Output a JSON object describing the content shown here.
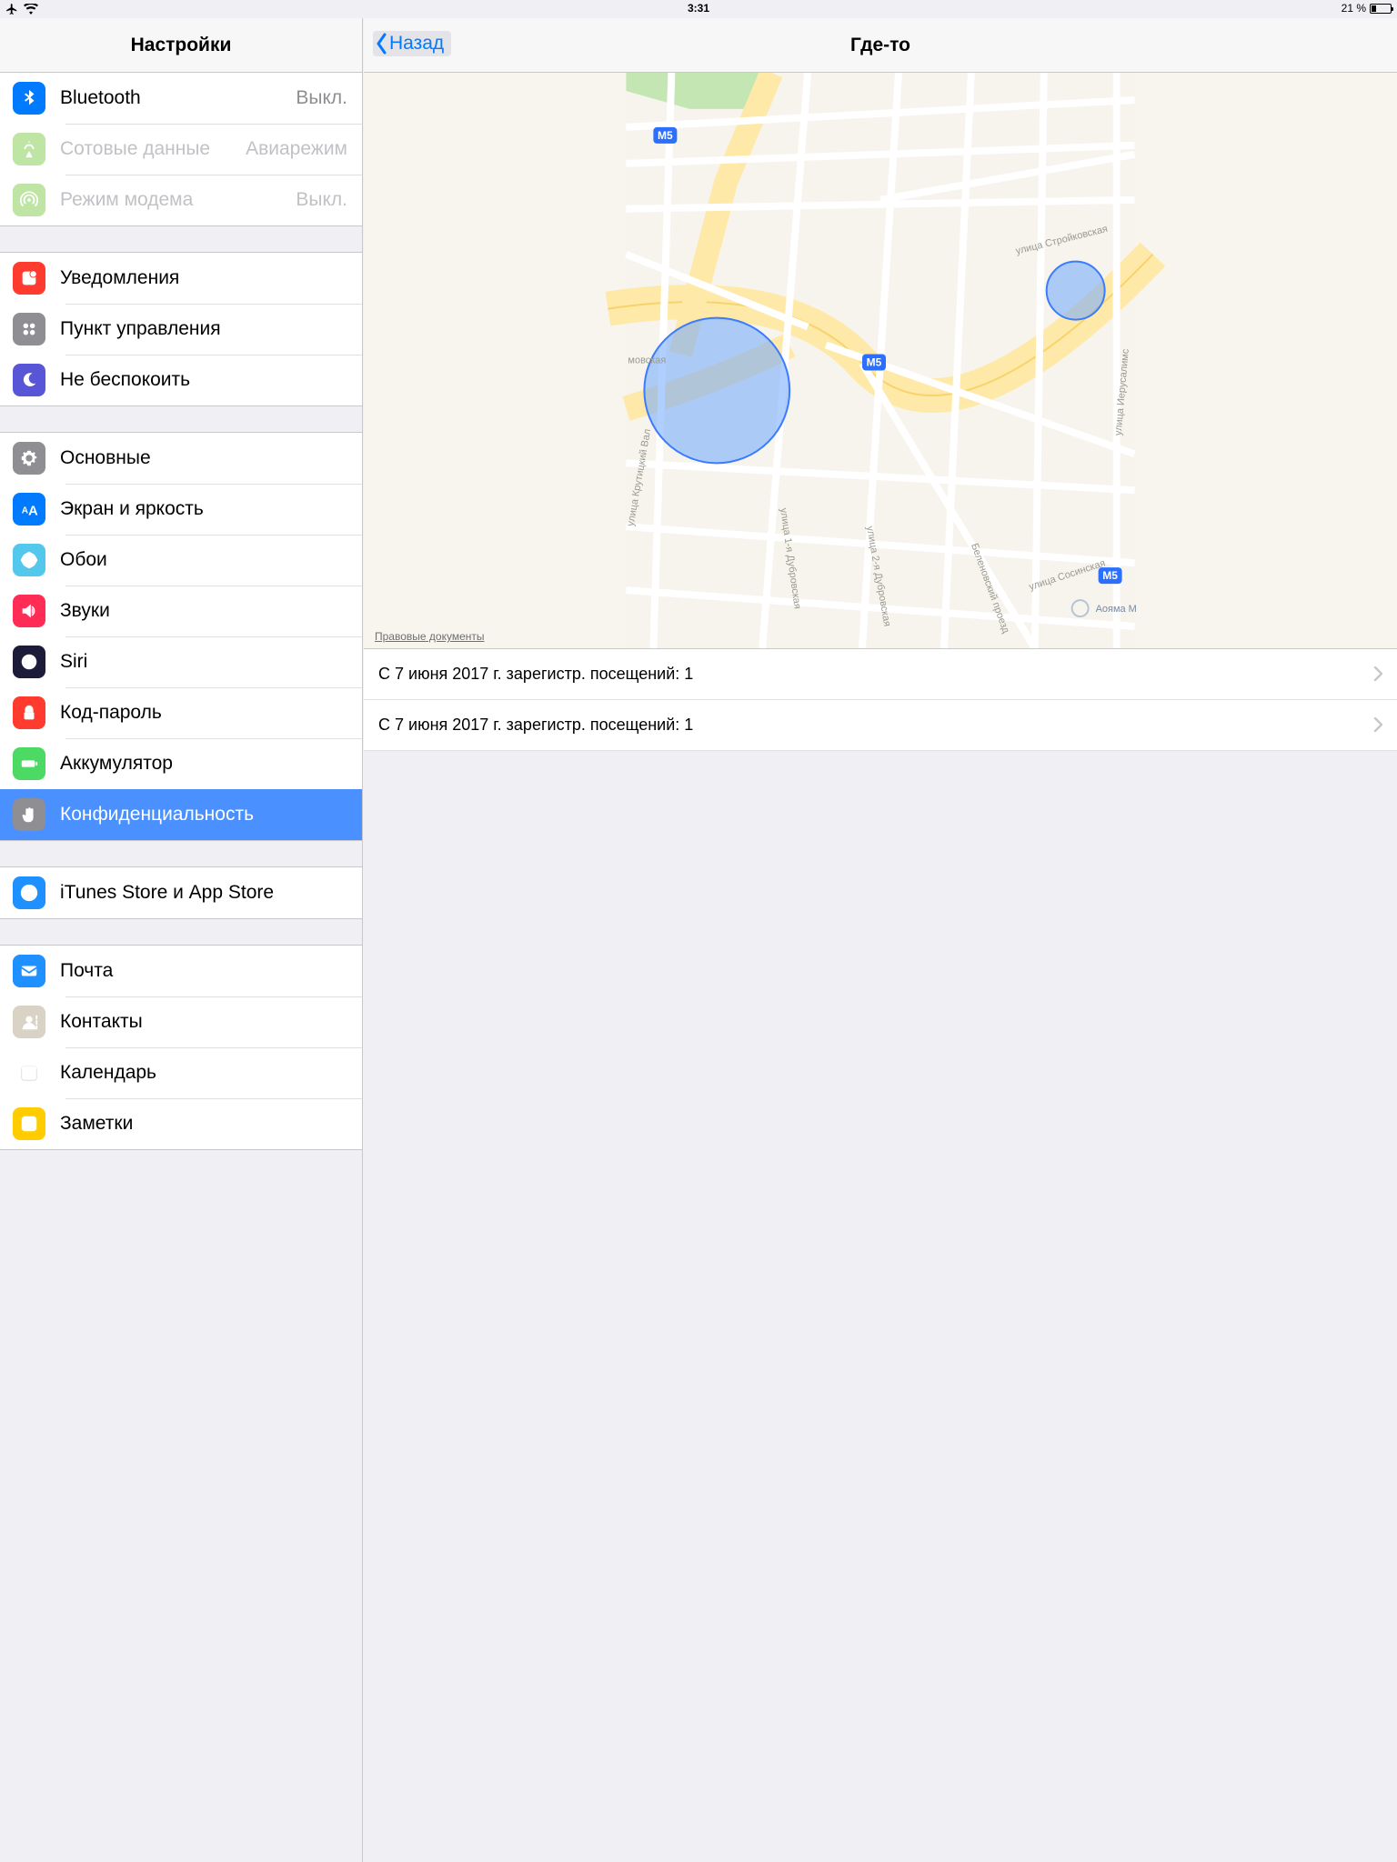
{
  "status": {
    "time": "3:31",
    "battery_text": "21 %",
    "battery_level": 21
  },
  "left": {
    "title": "Настройки",
    "groups": [
      [
        {
          "key": "bluetooth",
          "label": "Bluetooth",
          "detail": "Выкл.",
          "color": "#007aff",
          "icon": "bluetooth"
        },
        {
          "key": "cellular",
          "label": "Сотовые данные",
          "detail": "Авиарежим",
          "color": "#8ad158",
          "icon": "cellular",
          "disabled": true
        },
        {
          "key": "hotspot",
          "label": "Режим модема",
          "detail": "Выкл.",
          "color": "#8ad158",
          "icon": "hotspot",
          "disabled": true
        }
      ],
      [
        {
          "key": "notifications",
          "label": "Уведомления",
          "color": "#ff3b30",
          "icon": "notifications"
        },
        {
          "key": "controlcenter",
          "label": "Пункт управления",
          "color": "#8e8e93",
          "icon": "controlcenter"
        },
        {
          "key": "dnd",
          "label": "Не беспокоить",
          "color": "#5856d6",
          "icon": "dnd"
        }
      ],
      [
        {
          "key": "general",
          "label": "Основные",
          "color": "#8e8e93",
          "icon": "gear"
        },
        {
          "key": "display",
          "label": "Экран и яркость",
          "color": "#007aff",
          "icon": "display"
        },
        {
          "key": "wallpaper",
          "label": "Обои",
          "color": "#54c7ec",
          "icon": "wallpaper"
        },
        {
          "key": "sounds",
          "label": "Звуки",
          "color": "#ff2d55",
          "icon": "sounds"
        },
        {
          "key": "siri",
          "label": "Siri",
          "color": "#1c1c3a",
          "icon": "siri"
        },
        {
          "key": "passcode",
          "label": "Код-пароль",
          "color": "#ff3b30",
          "icon": "lock"
        },
        {
          "key": "battery",
          "label": "Аккумулятор",
          "color": "#4cd964",
          "icon": "battery"
        },
        {
          "key": "privacy",
          "label": "Конфиденциальность",
          "color": "#8e8e93",
          "icon": "hand",
          "selected": true
        }
      ],
      [
        {
          "key": "store",
          "label": "iTunes Store и App Store",
          "color": "#1e90ff",
          "icon": "appstore"
        }
      ],
      [
        {
          "key": "mail",
          "label": "Почта",
          "color": "#1e90ff",
          "icon": "mail"
        },
        {
          "key": "contacts",
          "label": "Контакты",
          "color": "#d9d3c6",
          "icon": "contacts"
        },
        {
          "key": "calendar",
          "label": "Календарь",
          "color": "#ffffff",
          "icon": "calendar"
        },
        {
          "key": "notes",
          "label": "Заметки",
          "color": "#ffcc00",
          "icon": "notes"
        }
      ]
    ]
  },
  "right": {
    "back": "Назад",
    "title": "Где-то",
    "map_legal": "Правовые документы",
    "map_labels": {
      "road_badge": "M5",
      "street1": "улица Стройковская",
      "street2": "улица 1-я Дубровская",
      "street3": "улица 2-я Дубровская",
      "street4": "Беленовский проезд",
      "street5": "улица Сосинская",
      "street6": "улица Крутицкий Вал",
      "street7": "улица Иерусалимс",
      "street_cut": "мовская",
      "poi": "Аояма М"
    },
    "items": [
      "С 7 июня 2017 г. зарегистр. посещений: 1",
      "С 7 июня 2017 г. зарегистр. посещений: 1"
    ]
  }
}
